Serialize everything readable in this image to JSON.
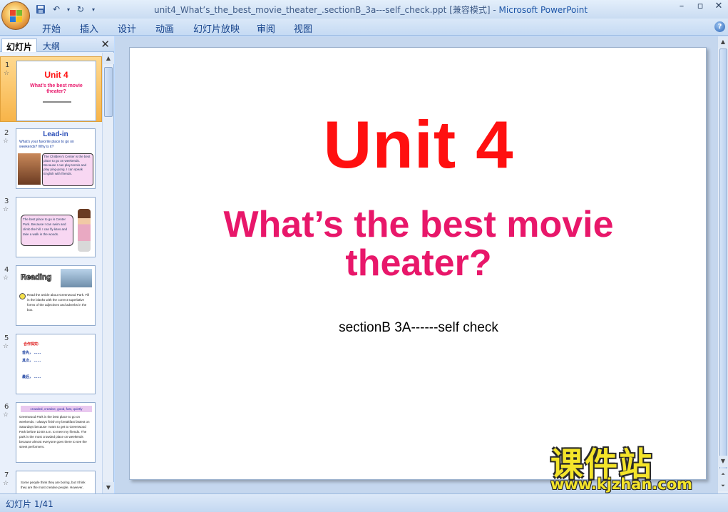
{
  "window": {
    "title": "unit4_What’s_the_best_movie_theater_.sectionB_3a---self_check.ppt [兼容模式]",
    "separator": " - ",
    "app_name": "Microsoft PowerPoint"
  },
  "ribbon": {
    "tabs": [
      "开始",
      "插入",
      "设计",
      "动画",
      "幻灯片放映",
      "审阅",
      "视图"
    ]
  },
  "left_panel": {
    "tabs": [
      "幻灯片",
      "大纲"
    ],
    "thumbnails": [
      {
        "num": "1",
        "title": "Unit 4",
        "line": "What’s the best movie theater?"
      },
      {
        "num": "2",
        "heading": "Lead-in",
        "line1": "What's your favorite place to go on weekends? Why is it?",
        "bubble": "The Children's Center is the best place to go on weekends. Because I can play tennis and play ping-pong. I can speak English with friends."
      },
      {
        "num": "3",
        "bubble": "The best place to go is Center Park. Because I can swim and climb the hill. I can fly kites and take a walk in the woods."
      },
      {
        "num": "4",
        "heading": "Reading",
        "line1": "Read the article about Greenwood Park. Fill in the blanks with the correct superlative forms of the adjectives and adverbs in the box."
      },
      {
        "num": "5",
        "line1": "合作探究：",
        "line2": "首先， ……",
        "line3": "其次， ……",
        "line4": "最后， ……"
      },
      {
        "num": "6",
        "box": "crowded, creative, good, fast, quietly",
        "line1": "Greenwood Park is the best place to go on weekends. I always finish my breakfast fastest on Saturdays because I want to get to Greenwood Park before 10:00 a.m. to meet my friends. The park is the most crowded place on weekends because almost everyone goes there to see the street performers."
      },
      {
        "num": "7",
        "line1": "Some people think they are boring, but I think they are the most creative people. However,"
      }
    ]
  },
  "slide": {
    "title": "Unit 4",
    "subtitle_line1": "What’s the best movie",
    "subtitle_line2": "theater?",
    "caption": "sectionB  3A------self check"
  },
  "watermark": {
    "line1": "课件站",
    "line2": "www.kjzhan.com"
  },
  "status_bar": {
    "slide_info": "幻灯片 1/41"
  },
  "colors": {
    "title_red": "#ff1010",
    "subtitle_pink": "#e8176a",
    "selected_thumb": "#f7b449"
  }
}
